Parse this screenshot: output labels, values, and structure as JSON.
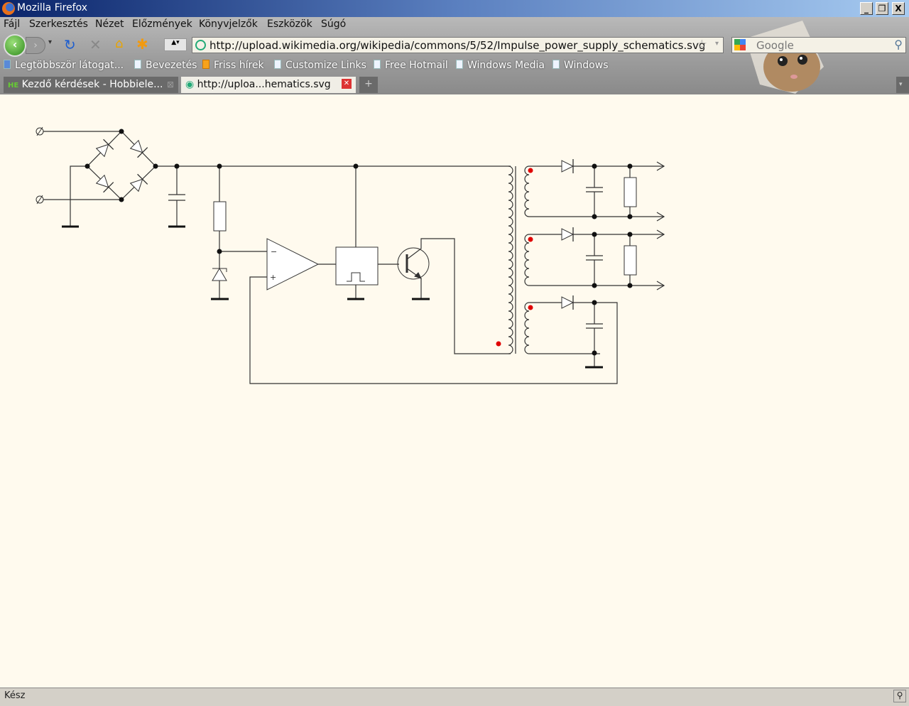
{
  "window": {
    "title": "Mozilla Firefox",
    "minimize": "_",
    "restore": "❐",
    "close": "X"
  },
  "menu": [
    "Fájl",
    "Szerkesztés",
    "Nézet",
    "Előzmények",
    "Könyvjelzők",
    "Eszközök",
    "Súgó"
  ],
  "nav": {
    "url": "http://upload.wikimedia.org/wikipedia/commons/5/52/Impulse_power_supply_schematics.svg",
    "search_placeholder": "Google"
  },
  "bookmarks": [
    "Legtöbbször látogat...",
    "Bevezetés",
    "Friss hírek",
    "Customize Links",
    "Free Hotmail",
    "Windows Media",
    "Windows"
  ],
  "tabs": [
    {
      "label": "Kezdő kérdések - Hobbiele...",
      "active": false
    },
    {
      "label": "http://uploa...hematics.svg",
      "active": true
    }
  ],
  "schematic": {
    "opamp_minus": "−",
    "opamp_plus": "+",
    "dot_color": "#e00000",
    "wire_color": "#333333"
  },
  "status": "Kész",
  "colors": {
    "page_bg": "#fffaee",
    "titlebar": "#0a246a"
  }
}
